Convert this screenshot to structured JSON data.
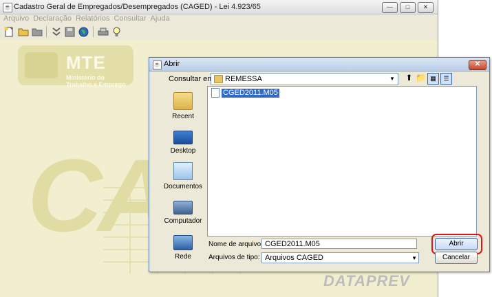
{
  "app": {
    "title": "Cadastro Geral de Empregados/Desempregados (CAGED) - Lei 4.923/65",
    "menu": [
      "Arquivo",
      "Declaração",
      "Relatórios",
      "Consultar",
      "Ajuda"
    ],
    "toolbar_icons": [
      "new-file-icon",
      "open-folder-icon",
      "folder-icon",
      "arrows-icon",
      "save-icon",
      "globe-icon",
      "print-icon",
      "lightbulb-icon"
    ],
    "logo_mte": "MTE",
    "logo_mte_caption": "Ministério do Trabalho e Emprego",
    "background_text": "CAGED",
    "footer_logo": "DATAPREV"
  },
  "dialog": {
    "title": "Abrir",
    "look_in_label": "Consultar em:",
    "look_in_value": "REMESSA",
    "places": [
      "Recent",
      "Desktop",
      "Documentos",
      "Computador",
      "Rede"
    ],
    "files": [
      "CGED2011.M05"
    ],
    "filename_label": "Nome de arquivo:",
    "filename_value": "CGED2011.M05",
    "filetype_label": "Arquivos de tipo:",
    "filetype_value": "Arquivos CAGED",
    "open_button": "Abrir",
    "cancel_button": "Cancelar"
  },
  "colors": {
    "highlight_ring": "#e01414",
    "selection": "#3169c6"
  }
}
